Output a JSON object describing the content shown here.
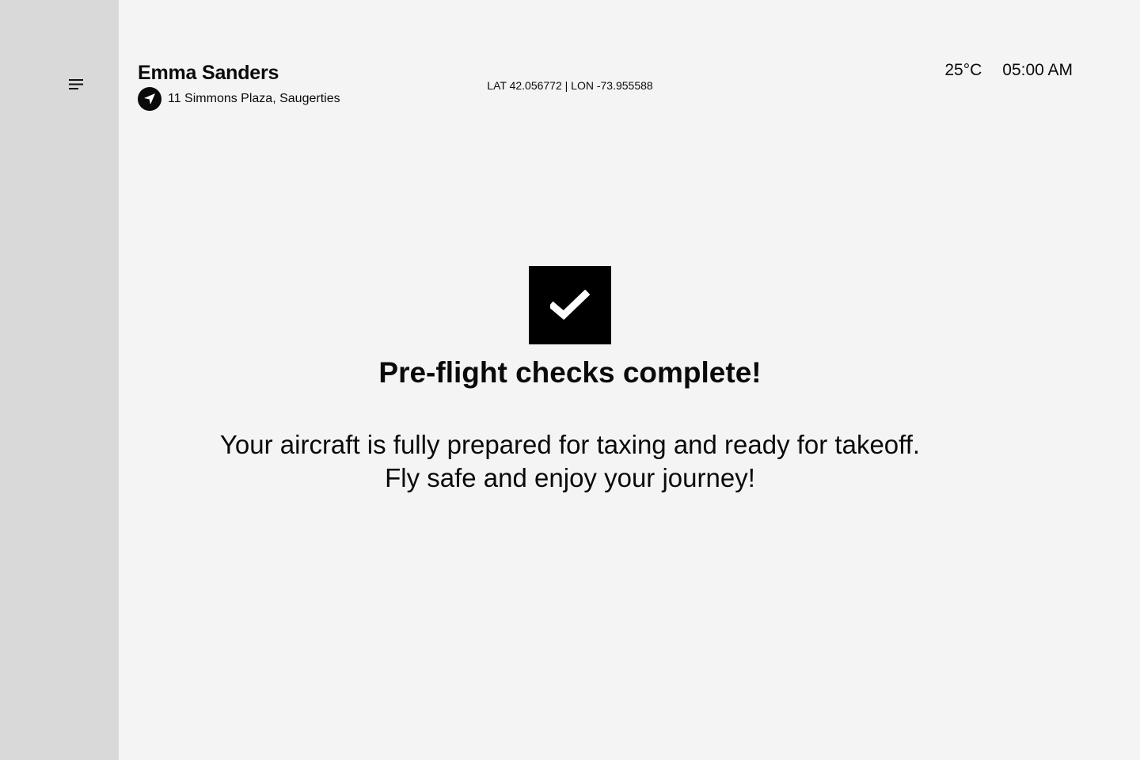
{
  "sidebar": {
    "menu_icon": "menu-icon"
  },
  "header": {
    "user_name": "Emma Sanders",
    "location_icon": "navigation-arrow-icon",
    "address": "11 Simmons Plaza, Saugerties",
    "coordinates": "LAT 42.056772 | LON -73.955588",
    "temperature": "25°C",
    "time": "05:00 AM"
  },
  "status": {
    "icon": "checkmark-icon",
    "title": "Pre-flight checks complete!",
    "message_line1": "Your aircraft is fully prepared for taxing and ready for takeoff.",
    "message_line2": "Fly safe and enjoy your journey!"
  },
  "colors": {
    "sidebar": "#d9d9d9",
    "background": "#f4f4f4",
    "accent": "#000000"
  }
}
